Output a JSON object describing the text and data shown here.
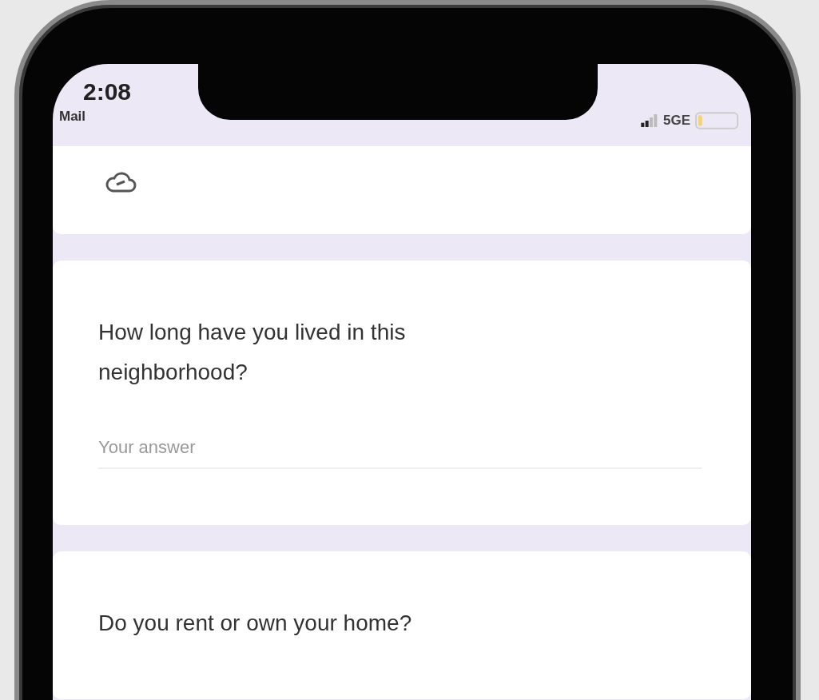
{
  "status_bar": {
    "time": "2:08",
    "back_app": "Mail",
    "network": "5GE"
  },
  "questions": [
    {
      "text": "How long have you lived in this neighborhood?",
      "placeholder": "Your answer"
    },
    {
      "text": "Do you rent or own your home?"
    }
  ]
}
